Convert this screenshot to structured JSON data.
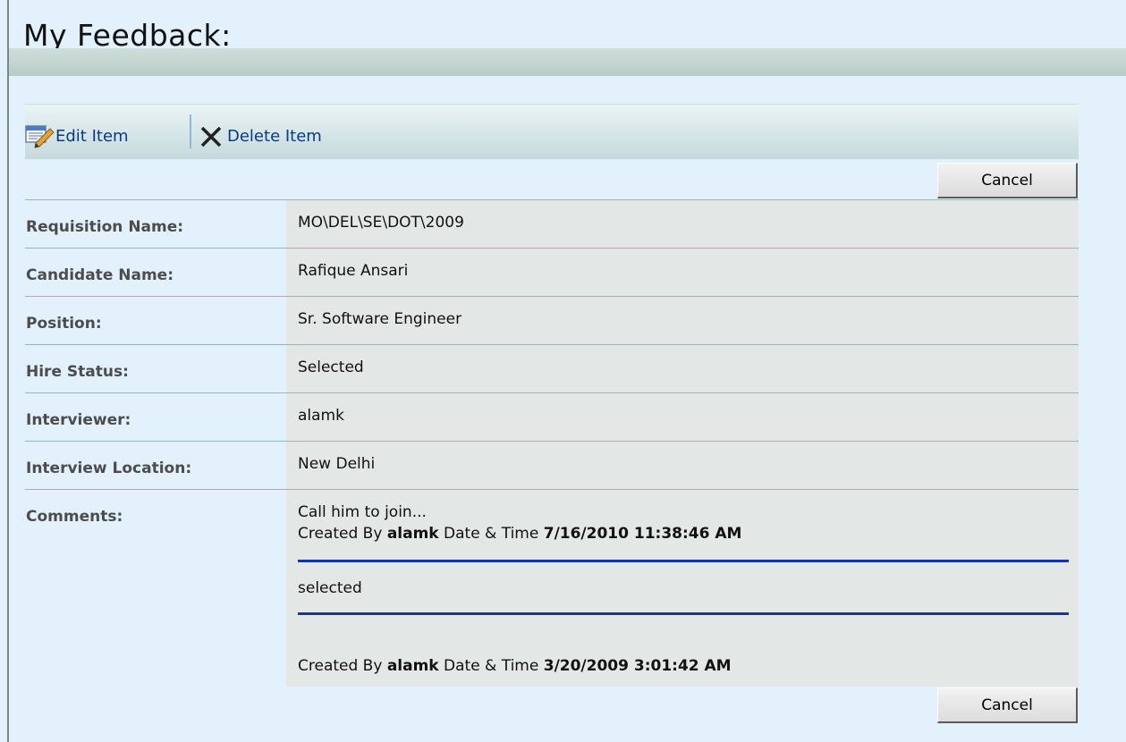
{
  "page": {
    "title": "My Feedback:"
  },
  "toolbar": {
    "edit_label": "Edit Item",
    "delete_label": "Delete Item"
  },
  "buttons": {
    "cancel_top": "Cancel",
    "cancel_bottom": "Cancel"
  },
  "fields": [
    {
      "label": "Requisition Name:",
      "value": "MO\\DEL\\SE\\DOT\\2009"
    },
    {
      "label": "Candidate Name:",
      "value": "Rafique Ansari"
    },
    {
      "label": "Position:",
      "value": "Sr. Software Engineer"
    },
    {
      "label": "Hire Status:",
      "value": "Selected"
    },
    {
      "label": "Interviewer:",
      "value": "alamk"
    },
    {
      "label": "Interview Location:",
      "value": "New Delhi"
    }
  ],
  "comments": {
    "label": "Comments:",
    "entries": [
      {
        "text": "Call him to join...",
        "created_by_prefix": "Created By",
        "author": "alamk",
        "date_prefix": "Date & Time",
        "datetime": "7/16/2010 11:38:46 AM"
      },
      {
        "text": "selected"
      },
      {
        "text": "",
        "created_by_prefix": "Created By",
        "author": "alamk",
        "date_prefix": "Date & Time",
        "datetime": "3/20/2009 3:01:42 AM"
      }
    ]
  },
  "colors": {
    "page_bg": "#e2f1fb",
    "link": "#0b3a85",
    "row_line": "#86bdb5",
    "comment_separator": "#1736a1",
    "value_bg": "#e3e7e6"
  }
}
